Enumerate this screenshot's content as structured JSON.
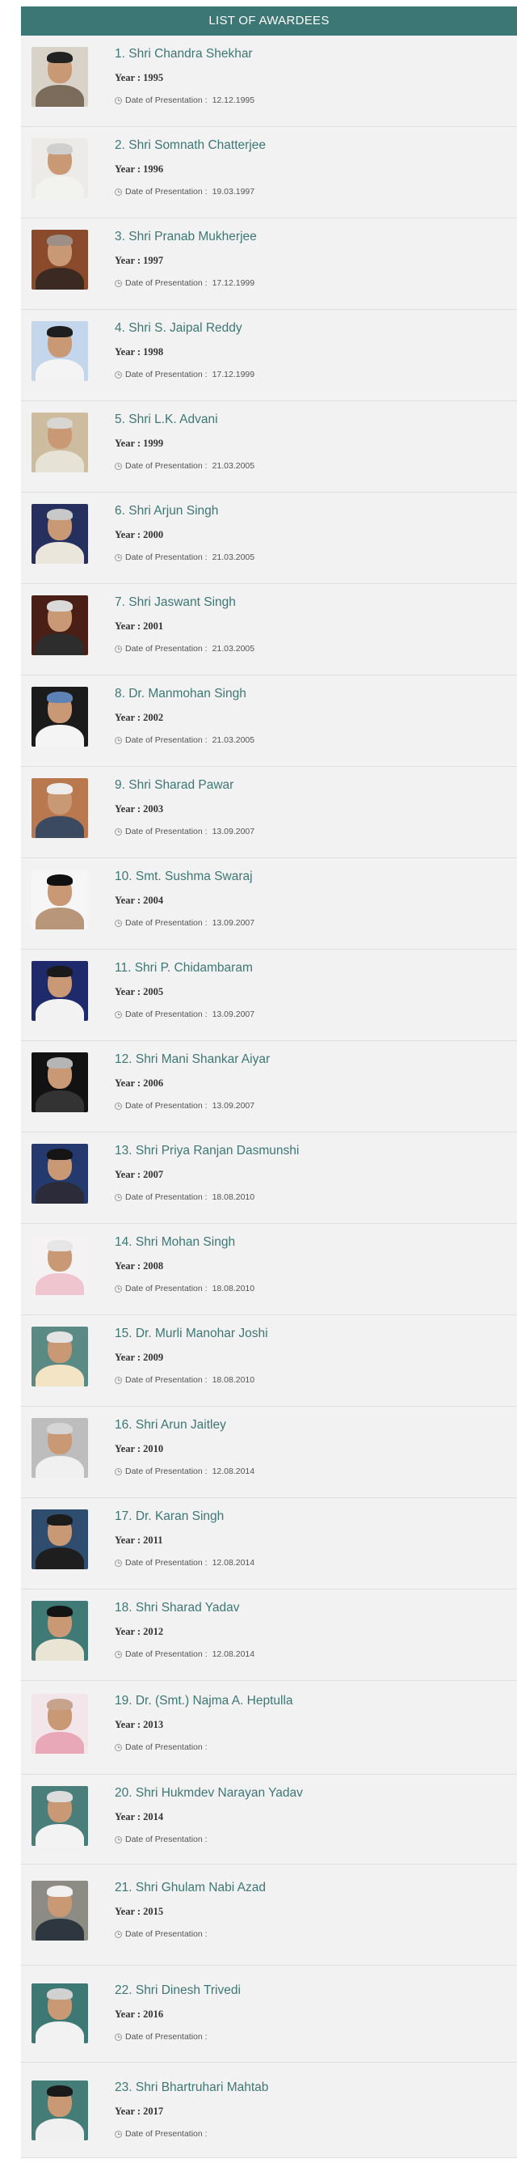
{
  "header": {
    "title": "LIST OF AWARDEES"
  },
  "date_label": "Date of Presentation :",
  "awardees": [
    {
      "name": "1. Shri Chandra Shekhar",
      "year": "Year : 1995",
      "date": "12.12.1995",
      "photo_bg": "#d9d2c8",
      "hair": "#222222",
      "body": "#7a6b5a"
    },
    {
      "name": "2. Shri Somnath Chatterjee",
      "year": "Year : 1996",
      "date": "19.03.1997",
      "photo_bg": "#ecebe7",
      "hair": "#cfcfcf",
      "body": "#f2f2ee"
    },
    {
      "name": "3. Shri Pranab Mukherjee",
      "year": "Year : 1997",
      "date": "17.12.1999",
      "photo_bg": "#8a4a2c",
      "hair": "#9d8f86",
      "body": "#3b2a22"
    },
    {
      "name": "4. Shri S. Jaipal Reddy",
      "year": "Year : 1998",
      "date": "17.12.1999",
      "photo_bg": "#c4d6ec",
      "hair": "#1e1e1e",
      "body": "#f4f4f4"
    },
    {
      "name": "5. Shri L.K. Advani",
      "year": "Year : 1999",
      "date": "21.03.2005",
      "photo_bg": "#cdbd9e",
      "hair": "#d8d6d2",
      "body": "#e7e2d6"
    },
    {
      "name": "6. Shri Arjun Singh",
      "year": "Year : 2000",
      "date": "21.03.2005",
      "photo_bg": "#26305f",
      "hair": "#c8c8c8",
      "body": "#ebe6dc"
    },
    {
      "name": "7. Shri Jaswant Singh",
      "year": "Year : 2001",
      "date": "21.03.2005",
      "photo_bg": "#4a1f16",
      "hair": "#d9d9d9",
      "body": "#2d2d2d"
    },
    {
      "name": "8. Dr. Manmohan Singh",
      "year": "Year : 2002",
      "date": "21.03.2005",
      "photo_bg": "#1b1b1b",
      "hair": "#5d82b6",
      "body": "#f4f4f4"
    },
    {
      "name": "9. Shri Sharad Pawar",
      "year": "Year : 2003",
      "date": "13.09.2007",
      "photo_bg": "#b9784e",
      "hair": "#ececec",
      "body": "#3b4a60"
    },
    {
      "name": "10. Smt. Sushma Swaraj",
      "year": "Year : 2004",
      "date": "13.09.2007",
      "photo_bg": "#f6f6f6",
      "hair": "#111111",
      "body": "#b7967a"
    },
    {
      "name": "11. Shri P. Chidambaram",
      "year": "Year : 2005",
      "date": "13.09.2007",
      "photo_bg": "#1e2a6a",
      "hair": "#1a1a1a",
      "body": "#f2f2f2"
    },
    {
      "name": "12. Shri Mani Shankar Aiyar",
      "year": "Year : 2006",
      "date": "13.09.2007",
      "photo_bg": "#121212",
      "hair": "#b5b5b5",
      "body": "#333333"
    },
    {
      "name": "13. Shri Priya Ranjan Dasmunshi",
      "year": "Year : 2007",
      "date": "18.08.2010",
      "photo_bg": "#243a6e",
      "hair": "#151515",
      "body": "#2b2b3a"
    },
    {
      "name": "14. Shri Mohan Singh",
      "year": "Year : 2008",
      "date": "18.08.2010",
      "photo_bg": "#f4f2f2",
      "hair": "#e6e6e6",
      "body": "#efc6cf"
    },
    {
      "name": "15. Dr. Murli Manohar Joshi",
      "year": "Year : 2009",
      "date": "18.08.2010",
      "photo_bg": "#5b8a84",
      "hair": "#e3e3e3",
      "body": "#f3e4c6"
    },
    {
      "name": "16. Shri Arun Jaitley",
      "year": "Year : 2010",
      "date": "12.08.2014",
      "photo_bg": "#bdbdbd",
      "hair": "#d5d5d5",
      "body": "#f0f0f0"
    },
    {
      "name": "17. Dr. Karan Singh",
      "year": "Year : 2011",
      "date": "12.08.2014",
      "photo_bg": "#2f4d6f",
      "hair": "#1c1c1c",
      "body": "#1e1e1e"
    },
    {
      "name": "18. Shri Sharad Yadav",
      "year": "Year : 2012",
      "date": "12.08.2014",
      "photo_bg": "#3f7a76",
      "hair": "#141414",
      "body": "#e9e4d4"
    },
    {
      "name": "19. Dr. (Smt.) Najma A. Heptulla",
      "year": "Year : 2013",
      "date": "",
      "photo_bg": "#f2e6ea",
      "hair": "#c7a28c",
      "body": "#e9a8b8"
    },
    {
      "name": "20. Shri Hukmdev Narayan Yadav",
      "year": "Year : 2014",
      "date": "",
      "photo_bg": "#4a7e7a",
      "hair": "#dcdcdc",
      "body": "#f3f3f3"
    },
    {
      "name": "21. Shri Ghulam Nabi Azad",
      "year": "Year : 2015",
      "date": "",
      "photo_bg": "#8c8c84",
      "hair": "#f1f1f1",
      "body": "#2e3640"
    },
    {
      "name": "22. Shri Dinesh Trivedi",
      "year": "Year : 2016",
      "date": "",
      "photo_bg": "#3e7874",
      "hair": "#d1d1d1",
      "body": "#f2f2f2"
    },
    {
      "name": "23. Shri Bhartruhari Mahtab",
      "year": "Year : 2017",
      "date": "",
      "photo_bg": "#447c78",
      "hair": "#1a1a1a",
      "body": "#f0f0f0"
    }
  ]
}
